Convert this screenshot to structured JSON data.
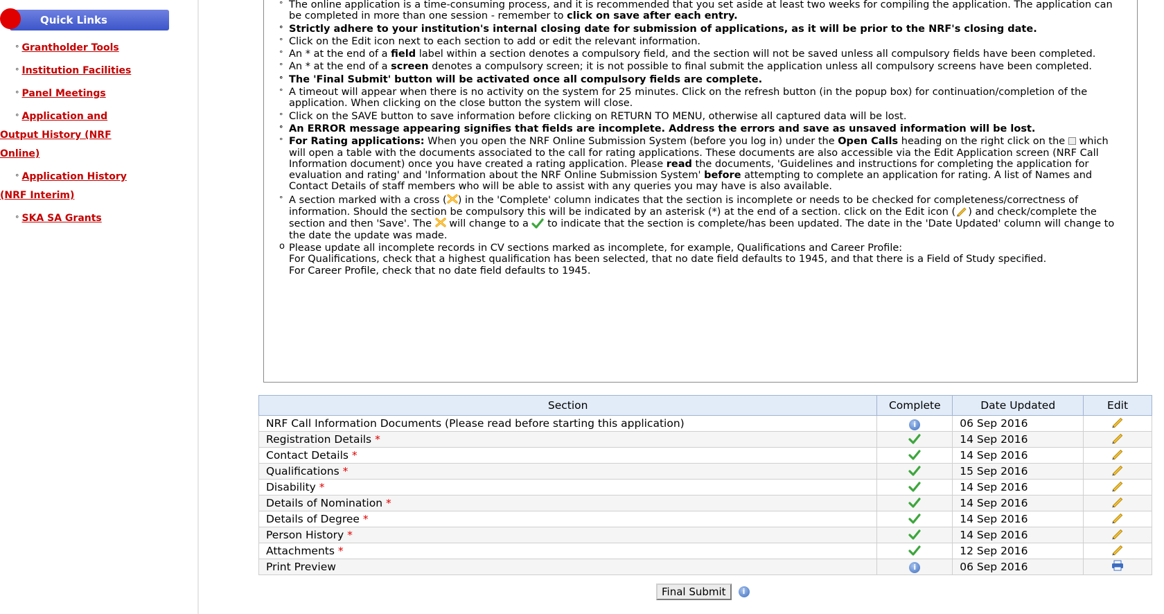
{
  "sidebar": {
    "header": "Quick Links",
    "links": [
      {
        "label": "Grantholder Tools"
      },
      {
        "label": "Institution Facilities"
      },
      {
        "label": "Panel Meetings"
      },
      {
        "label": "Application and Output History (NRF Online)"
      },
      {
        "label": "Application History (NRF Interim)"
      },
      {
        "label": "SKA SA Grants"
      }
    ]
  },
  "notes": {
    "n1a": "The online application is a time-consuming process, and it is recommended that you set aside at least two weeks for compiling the application. The application can be completed in more than one session - remember to ",
    "n1b": "click on save after each entry.",
    "n2": "Strictly adhere to your institution's internal closing date for submission of applications, as it will be prior to the NRF's closing date.",
    "n3": "Click on the Edit icon next to each section to add or edit the relevant information.",
    "n4a": "An * at the end of a ",
    "n4b": "field",
    "n4c": " label within a section denotes a compulsory field, and the section will not be saved unless all compulsory fields have been completed.",
    "n5a": "An * at the end of a ",
    "n5b": "screen",
    "n5c": " denotes a compulsory screen; it is not possible to final submit the application unless all compulsory screens have been completed.",
    "n6": "The 'Final Submit' button will be activated once all compulsory fields are complete.",
    "n7": "A timeout will appear when there is no activity on the system for 25 minutes. Click on the refresh button (in the popup box) for continuation/completion of the application. When clicking on the close button the system will close.",
    "n8": "Click on the SAVE button to save information before clicking on RETURN TO MENU, otherwise all captured data will be lost.",
    "n9": "An ERROR message appearing signifies that fields are incomplete. Address the errors and save as unsaved information will be lost.",
    "n10a": "For Rating applications:",
    "n10b": " When you open the NRF Online Submission System (before you log in) under the ",
    "n10c": "Open Calls",
    "n10d": " heading on the right click on the ",
    "n10e": " which will open a table with the documents associated to the call for rating applications. These documents are also accessible via the Edit Application screen (NRF Call Information document) once you have created a rating application. Please ",
    "n10f": "read",
    "n10g": " the documents, 'Guidelines and instructions for completing the application for evaluation and rating' and 'Information about the NRF Online Submission System' ",
    "n10h": "before",
    "n10i": " attempting to complete an application for rating. A list of Names and Contact Details of staff members who will be able to assist with any queries you may have is also available.",
    "n11a": "A section marked with a cross (",
    "n11b": ") in the 'Complete' column indicates that the section is incomplete or needs to be checked for completeness/correctness of information. Should the section be compulsory this will be indicated by an asterisk (*) at the end of a section. click on the Edit icon (",
    "n11c": ") and check/complete the section and then 'Save'. The ",
    "n11d": " will change to a ",
    "n11e": " to indicate that the section is complete/has been updated. The date in the 'Date Updated' column will change to the date the update was made.",
    "n12a": "Please update all incomplete records in CV sections marked as incomplete, for example, Qualifications and Career Profile:",
    "n12b": "For Qualifications, check that a highest qualification has been selected, that no date field defaults to 1945, and that there is a Field of Study specified.",
    "n12c": "For Career Profile, check that no date field defaults to 1945."
  },
  "table": {
    "headers": {
      "section": "Section",
      "complete": "Complete",
      "date": "Date Updated",
      "edit": "Edit"
    },
    "rows": [
      {
        "section": "NRF Call Information Documents (Please read before starting this application)",
        "required": "",
        "complete": "info",
        "date": "06 Sep 2016",
        "edit": "pencil"
      },
      {
        "section": "Registration Details",
        "required": "*",
        "complete": "tick",
        "date": "14 Sep 2016",
        "edit": "pencil"
      },
      {
        "section": "Contact Details",
        "required": "*",
        "complete": "tick",
        "date": "14 Sep 2016",
        "edit": "pencil"
      },
      {
        "section": "Qualifications",
        "required": "*",
        "complete": "tick",
        "date": "15 Sep 2016",
        "edit": "pencil"
      },
      {
        "section": "Disability",
        "required": "*",
        "complete": "tick",
        "date": "14 Sep 2016",
        "edit": "pencil"
      },
      {
        "section": "Details of Nomination",
        "required": "*",
        "complete": "tick",
        "date": "14 Sep 2016",
        "edit": "pencil"
      },
      {
        "section": "Details of Degree",
        "required": "*",
        "complete": "tick",
        "date": "14 Sep 2016",
        "edit": "pencil"
      },
      {
        "section": "Person History",
        "required": "*",
        "complete": "tick",
        "date": "14 Sep 2016",
        "edit": "pencil"
      },
      {
        "section": "Attachments",
        "required": "*",
        "complete": "tick",
        "date": "12 Sep 2016",
        "edit": "pencil"
      },
      {
        "section": "Print Preview",
        "required": "",
        "complete": "info",
        "date": "06 Sep 2016",
        "edit": "print"
      }
    ]
  },
  "actions": {
    "final_submit": "Final Submit"
  },
  "colors": {
    "link": "#c40000",
    "header_blue": "#3b55c9",
    "tick_green": "#3da63d",
    "required_red": "#e00000"
  }
}
